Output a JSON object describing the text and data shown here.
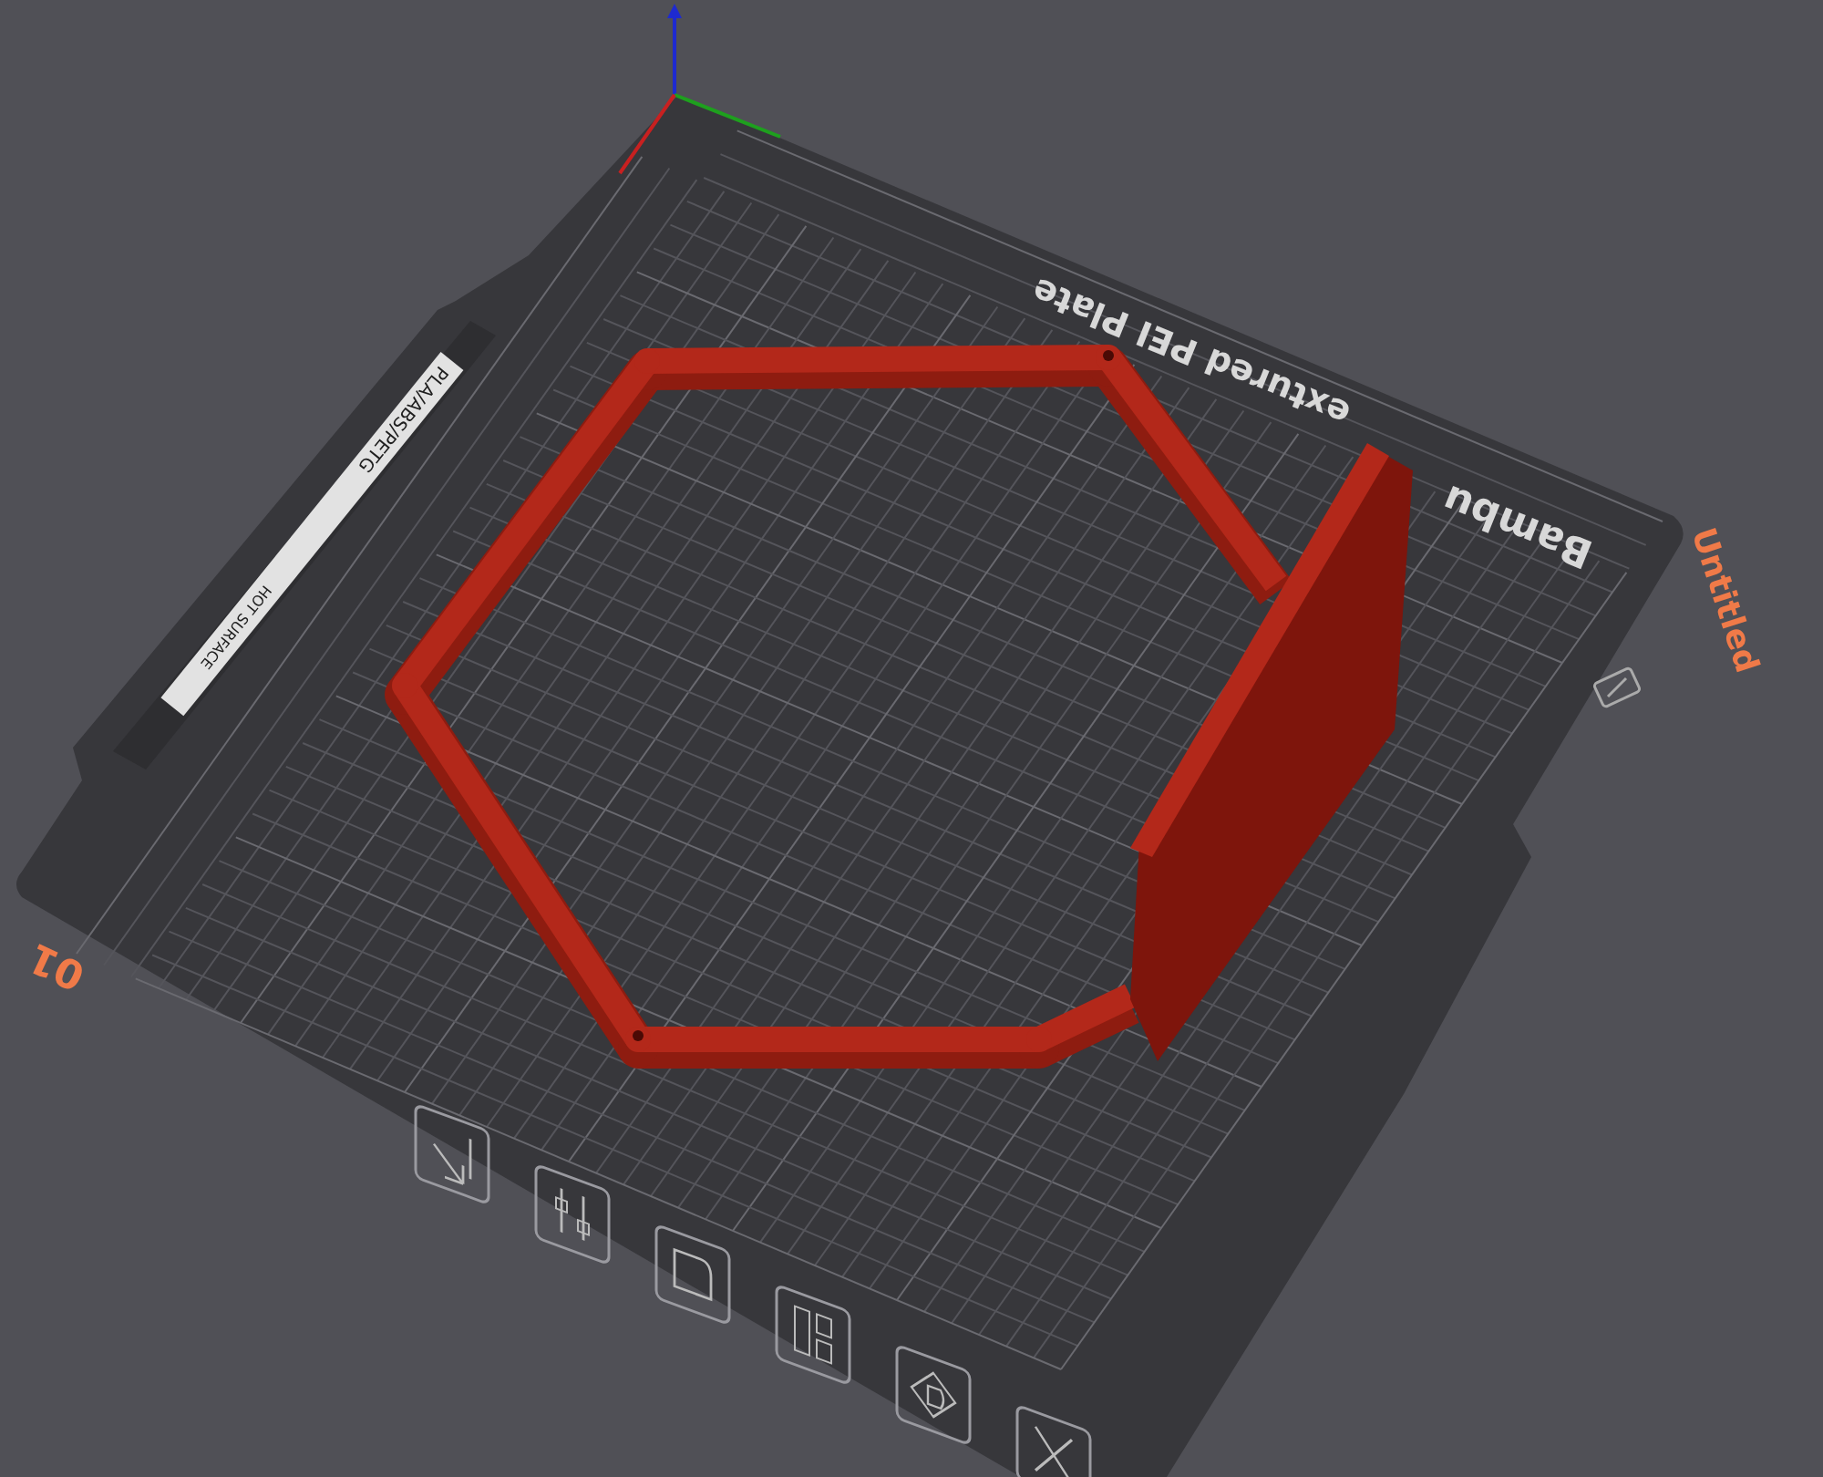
{
  "plate": {
    "name_parts": [
      "Bambu",
      "extured PEI Plate"
    ],
    "label": "Untitled",
    "number": "01",
    "sticker": {
      "materials": "PLA/ABS/PETG",
      "warning": "HOT SURFACE"
    }
  },
  "plate_tools": [
    {
      "kind": "arrange"
    },
    {
      "kind": "sliders"
    },
    {
      "kind": "orient"
    },
    {
      "kind": "layout"
    },
    {
      "kind": "lock"
    },
    {
      "kind": "close"
    }
  ]
}
